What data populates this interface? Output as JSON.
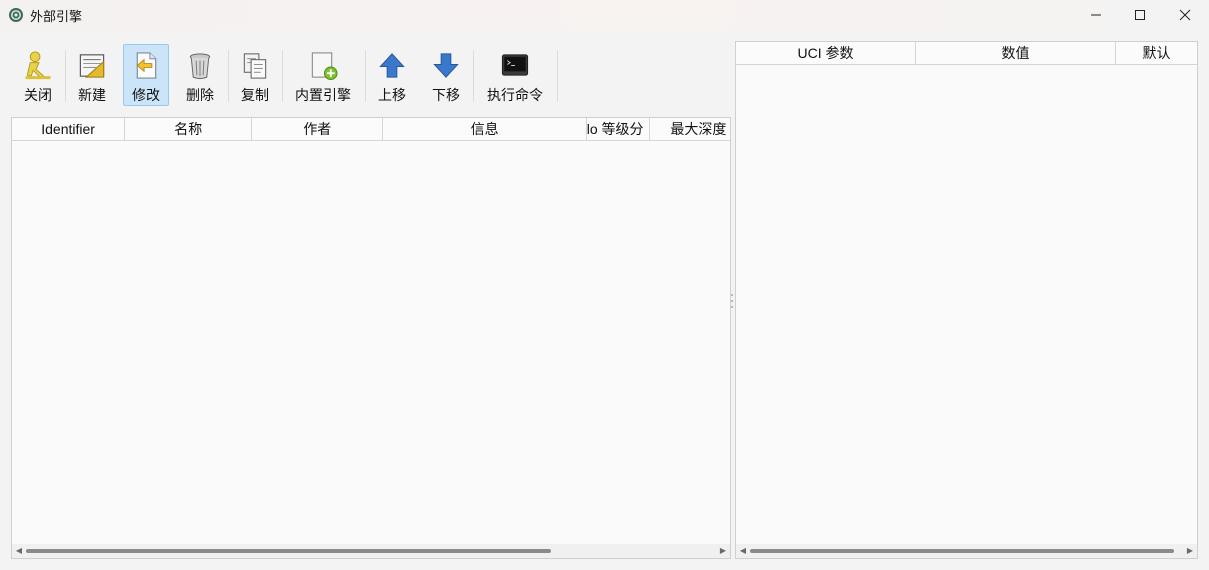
{
  "window": {
    "title": "外部引擎",
    "controls": [
      "minimize",
      "maximize",
      "close"
    ]
  },
  "toolbar": {
    "buttons": [
      {
        "label": "关闭",
        "icon": "close-person-icon",
        "active": false
      },
      {
        "label": "新建",
        "icon": "new-document-icon",
        "active": false
      },
      {
        "label": "修改",
        "icon": "edit-document-icon",
        "active": true
      },
      {
        "label": "删除",
        "icon": "trash-icon",
        "active": false
      },
      {
        "label": "复制",
        "icon": "copy-icon",
        "active": false
      },
      {
        "label": "内置引擎",
        "icon": "add-page-icon",
        "active": false
      },
      {
        "label": "上移",
        "icon": "arrow-up-icon",
        "active": false
      },
      {
        "label": "下移",
        "icon": "arrow-down-icon",
        "active": false
      },
      {
        "label": "执行命令",
        "icon": "terminal-icon",
        "active": false
      }
    ]
  },
  "engine_table": {
    "columns": [
      "Identifier",
      "名称",
      "作者",
      "信息",
      ":lo 等级分",
      "最大深度"
    ],
    "rows": []
  },
  "uci_table": {
    "columns": [
      "UCI 参数",
      "数值",
      "默认"
    ],
    "rows": []
  },
  "colors": {
    "active_button": "#cce4f7",
    "arrow_blue": "#2f6fc4",
    "background": "#f3f3f3"
  }
}
